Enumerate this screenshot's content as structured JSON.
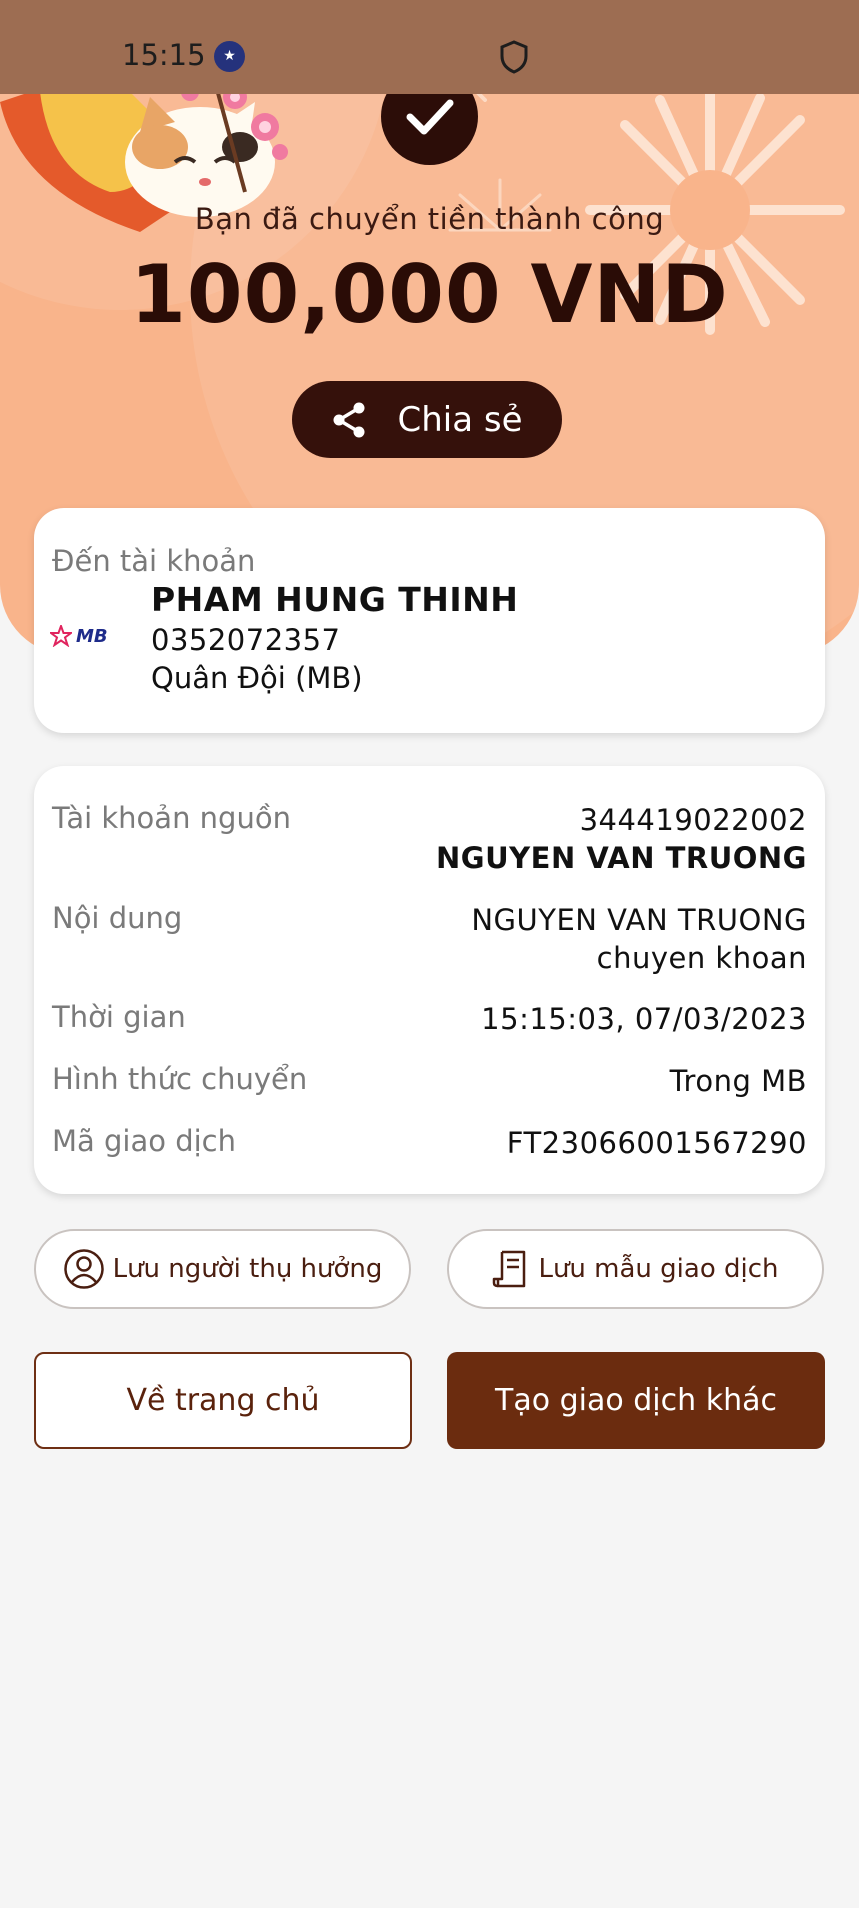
{
  "status_bar": {
    "time": "15:15",
    "flag_icon": "australia-flag-icon",
    "shield_icon": "shield-icon"
  },
  "header": {
    "success_message": "Bạn đã chuyển tiền thành công",
    "amount": "100,000 VND",
    "share_label": "Chia sẻ",
    "background_color": "#f9b48b"
  },
  "recipient": {
    "label": "Đến tài khoản",
    "name": "PHAM HUNG THINH",
    "account_number": "0352072357",
    "bank": "Quân Đội (MB)",
    "bank_logo_text": "MB"
  },
  "details": {
    "rows": [
      {
        "key": "Tài khoản nguồn",
        "value": "344419022002",
        "value2": "NGUYEN VAN TRUONG"
      },
      {
        "key": "Nội dung",
        "value": "NGUYEN VAN TRUONG",
        "value2": "chuyen khoan"
      },
      {
        "key": "Thời gian",
        "value": "15:15:03, 07/03/2023"
      },
      {
        "key": "Hình thức chuyển",
        "value": "Trong MB"
      },
      {
        "key": "Mã giao dịch",
        "value": "FT23066001567290"
      }
    ]
  },
  "actions": {
    "save_beneficiary": "Lưu người thụ hưởng",
    "save_template": "Lưu mẫu giao dịch",
    "home": "Về trang chủ",
    "new_transaction": "Tạo giao dịch khác"
  },
  "colors": {
    "brand_dark": "#35110b",
    "brand_brown": "#6b2c0f"
  }
}
